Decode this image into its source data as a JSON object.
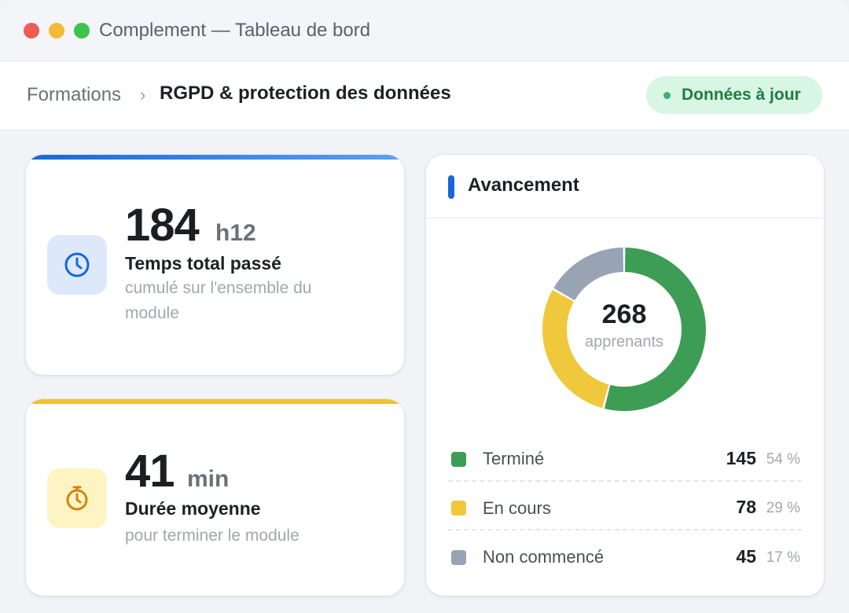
{
  "window": {
    "title": "Complement — Tableau de bord"
  },
  "breadcrumb": {
    "parent": "Formations",
    "separator": "›",
    "current": "RGPD & protection des données"
  },
  "status": {
    "label": "Données à jour",
    "color": "#3cb26a"
  },
  "kpis": [
    {
      "value": "184",
      "unit": "h12",
      "label": "Temps total passé",
      "sub": "cumulé sur l'ensemble du module",
      "icon": "clock-icon",
      "accent": "#1668d9"
    },
    {
      "value": "41",
      "unit": "min",
      "label": "Durée moyenne",
      "sub": "pour terminer le module",
      "icon": "timer-icon",
      "accent": "#f0c232"
    }
  ],
  "progress": {
    "title": "Avancement",
    "total": "268",
    "total_caption": "apprenants",
    "items": [
      {
        "label": "Terminé",
        "count": "145",
        "pct": "54 %",
        "value": 145,
        "color": "#3d9d54"
      },
      {
        "label": "En cours",
        "count": "78",
        "pct": "29 %",
        "value": 78,
        "color": "#f0c83c"
      },
      {
        "label": "Non commencé",
        "count": "45",
        "pct": "17 %",
        "value": 45,
        "color": "#98a3b4"
      }
    ]
  }
}
